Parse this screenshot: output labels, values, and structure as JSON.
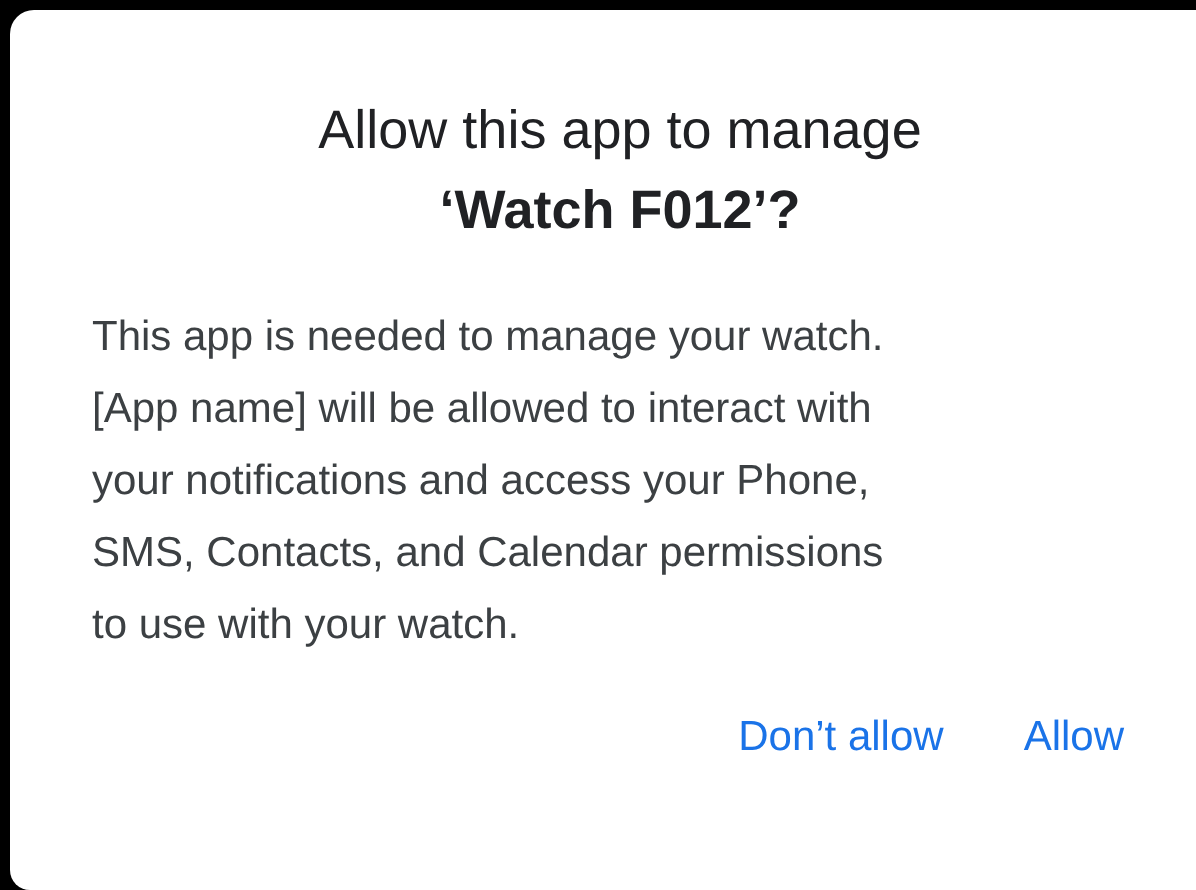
{
  "dialog": {
    "title": "Allow this app to manage **‘Watch F012’?**",
    "message": "This app is needed to manage your watch.\n[App name] will be allowed to interact with\nyour notifications and access your Phone,\nSMS, Contacts, and Calendar permissions\nto use with your watch.",
    "buttons": [
      {
        "label": "Don’t allow"
      },
      {
        "label": "Allow"
      }
    ]
  }
}
